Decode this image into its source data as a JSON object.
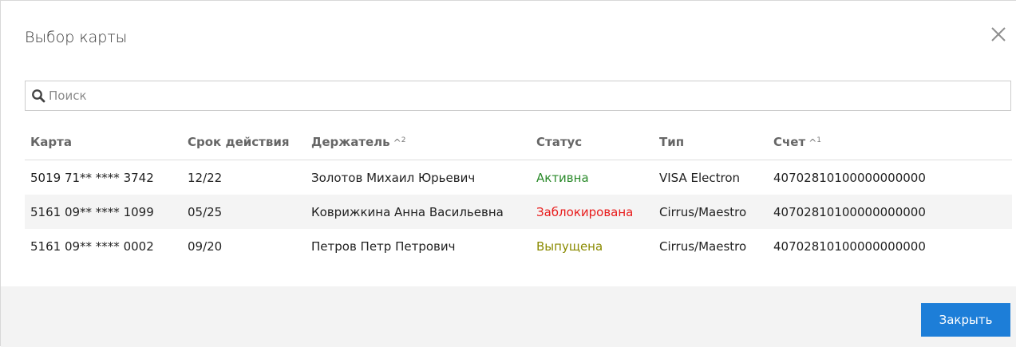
{
  "dialog": {
    "title": "Выбор карты",
    "close_icon": "close-icon",
    "close_button_label": "Закрыть"
  },
  "search": {
    "placeholder": "Поиск",
    "icon": "search-icon"
  },
  "columns": [
    {
      "label": "Карта",
      "sort": ""
    },
    {
      "label": "Срок действия",
      "sort": ""
    },
    {
      "label": "Держатель",
      "sort": "^",
      "sort_order": "2"
    },
    {
      "label": "Статус",
      "sort": ""
    },
    {
      "label": "Тип",
      "sort": ""
    },
    {
      "label": "Счет",
      "sort": "^",
      "sort_order": "1"
    }
  ],
  "rows": [
    {
      "card": "5019 71** **** 3742",
      "expiry": "12/22",
      "holder": "Золотов Михаил Юрьевич",
      "status": "Активна",
      "type": "VISA Electron",
      "account": "40702810100000000000"
    },
    {
      "card": "5161 09** **** 1099",
      "expiry": "05/25",
      "holder": "Коврижкина Анна Васильевна",
      "status": "Заблокирована",
      "type": "Cirrus/Maestro",
      "account": "40702810100000000000"
    },
    {
      "card": "5161 09** **** 0002",
      "expiry": "09/20",
      "holder": "Петров Петр Петрович",
      "status": "Выпущена",
      "type": "Cirrus/Maestro",
      "account": "40702810100000000000"
    }
  ],
  "colors": {
    "accent": "#1d7ed8",
    "status_active": "#2a8a2a",
    "status_blocked": "#e81c1c",
    "status_issued": "#8a8a00"
  }
}
